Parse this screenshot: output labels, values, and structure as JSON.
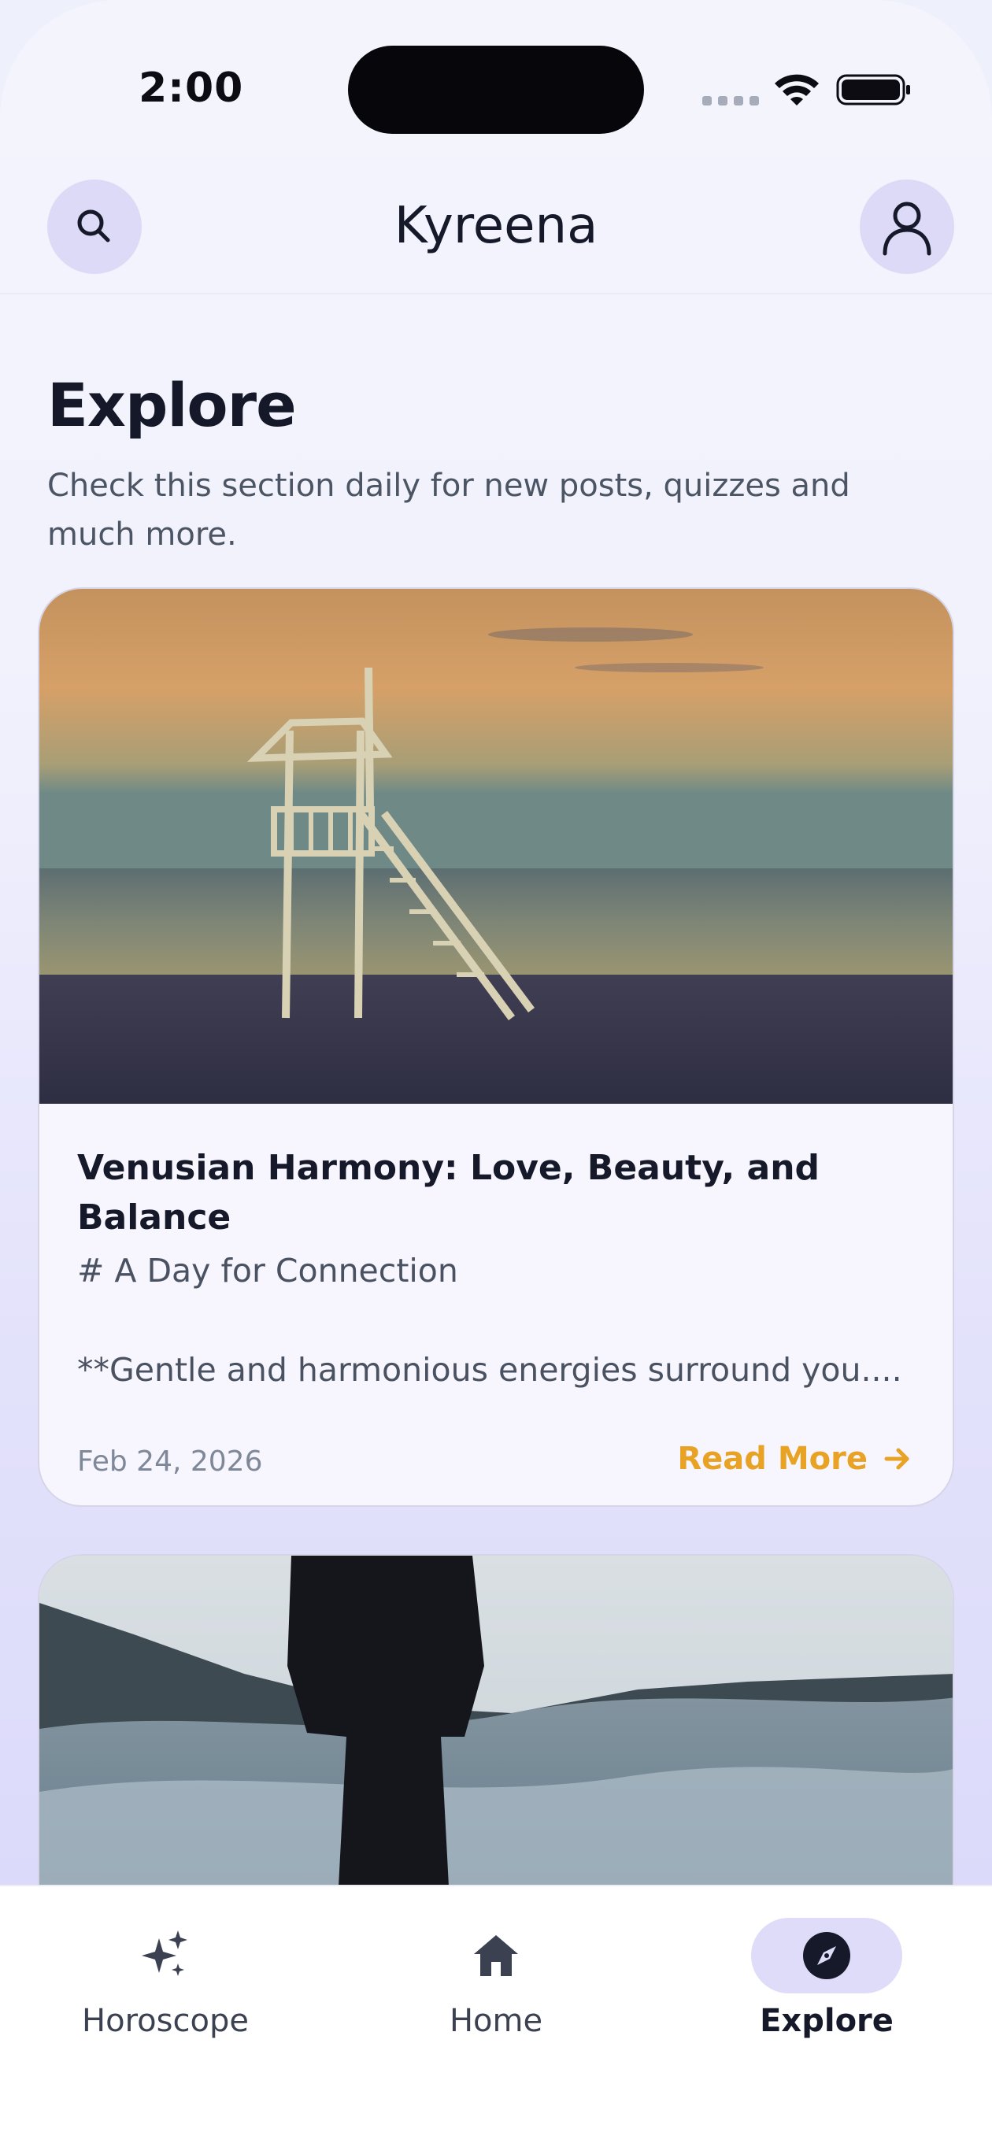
{
  "status_bar": {
    "time": "2:00"
  },
  "app_bar": {
    "title": "Kyreena",
    "search_icon": "search-icon",
    "profile_icon": "user-icon"
  },
  "page": {
    "title": "Explore",
    "subtitle": "Check this section daily for new posts, quizzes and much more."
  },
  "posts": [
    {
      "image": "lifeguard-tower-beach-sunset",
      "title": "Venusian Harmony: Love, Beauty, and Balance",
      "tagline": "# A Day for Connection",
      "excerpt": "**Gentle and harmonious energies surround you....",
      "date": "Feb 24, 2026",
      "read_more": "Read More"
    },
    {
      "image": "person-standing-in-misty-mountains"
    }
  ],
  "bottom_nav": {
    "items": [
      {
        "label": "Horoscope",
        "icon": "sparkles-icon",
        "active": false
      },
      {
        "label": "Home",
        "icon": "home-icon",
        "active": false
      },
      {
        "label": "Explore",
        "icon": "compass-icon",
        "active": true
      }
    ]
  },
  "colors": {
    "accent": "#e8a224",
    "active_pill": "#dedcf8",
    "circle_button": "#dcdaf7",
    "text_primary": "#151929",
    "text_secondary": "#4a5262"
  }
}
